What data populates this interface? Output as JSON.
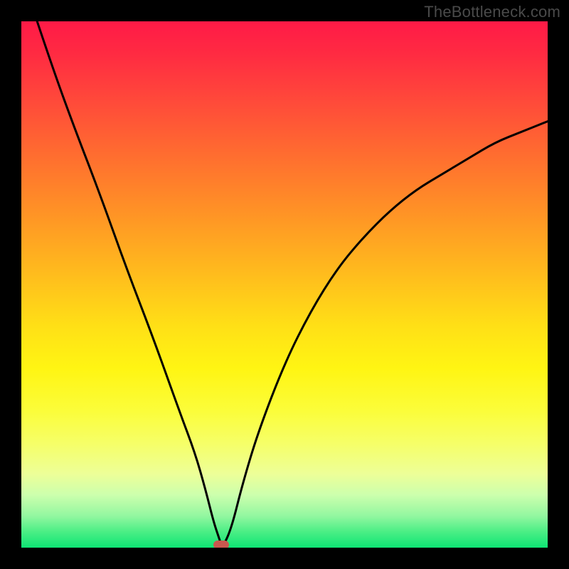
{
  "watermark": "TheBottleneck.com",
  "chart_data": {
    "type": "line",
    "title": "",
    "xlabel": "",
    "ylabel": "",
    "xlim": [
      0,
      100
    ],
    "ylim": [
      0,
      100
    ],
    "grid": false,
    "legend": false,
    "series": [
      {
        "name": "bottleneck-curve",
        "x": [
          3,
          6,
          10,
          15,
          20,
          25,
          30,
          33,
          35,
          36.5,
          37.5,
          38,
          38.5,
          40,
          42,
          45,
          50,
          55,
          60,
          65,
          70,
          75,
          80,
          85,
          90,
          95,
          100
        ],
        "y": [
          100,
          91,
          80,
          67,
          53,
          40,
          26,
          18,
          11,
          5,
          2,
          0.5,
          0.5,
          4,
          12,
          22,
          35,
          45,
          53,
          59,
          64,
          68,
          71,
          74,
          77,
          79,
          81
        ]
      }
    ],
    "marker": {
      "x": 38,
      "y": 0.5,
      "color": "#c9584f"
    },
    "gradient_colors": {
      "top": "#ff1a47",
      "mid_upper": "#ff9525",
      "mid": "#fff513",
      "mid_lower": "#f6ff66",
      "bottom": "#0ee574"
    },
    "background": "#000000"
  }
}
